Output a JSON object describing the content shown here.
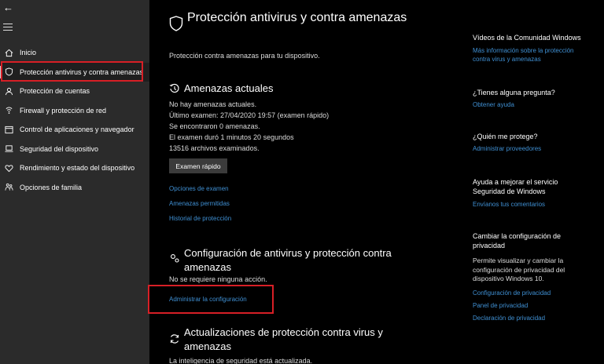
{
  "sidebar": {
    "back_glyph": "←",
    "items": [
      {
        "label": "Inicio",
        "icon": "home-icon"
      },
      {
        "label": "Protección antivirus y contra amenazas",
        "icon": "shield-icon"
      },
      {
        "label": "Protección de cuentas",
        "icon": "person-icon"
      },
      {
        "label": "Firewall y protección de red",
        "icon": "wifi-icon"
      },
      {
        "label": "Control de aplicaciones y navegador",
        "icon": "window-icon"
      },
      {
        "label": "Seguridad del dispositivo",
        "icon": "laptop-icon"
      },
      {
        "label": "Rendimiento y estado del dispositivo",
        "icon": "heart-icon"
      },
      {
        "label": "Opciones de familia",
        "icon": "family-icon"
      }
    ]
  },
  "main": {
    "title": "Protección antivirus y contra amenazas",
    "subtitle": "Protección contra amenazas para tu dispositivo.",
    "threats": {
      "title": "Amenazas actuales",
      "lines": [
        "No hay amenazas actuales.",
        "Último examen: 27/04/2020 19:57 (examen rápido)",
        "Se encontraron 0 amenazas.",
        "El examen duró 1 minutos 20 segundos",
        "13516 archivos examinados."
      ],
      "button": "Examen rápido",
      "links": [
        "Opciones de examen",
        "Amenazas permitidas",
        "Historial de protección"
      ]
    },
    "settings": {
      "title": "Configuración de antivirus y protección contra amenazas",
      "status": "No se requiere ninguna acción.",
      "link": "Administrar la configuración"
    },
    "updates": {
      "title": "Actualizaciones de protección contra virus y amenazas",
      "status": "La inteligencia de seguridad está actualizada."
    }
  },
  "right": {
    "community": {
      "head": "Vídeos de la Comunidad Windows",
      "link": "Más información sobre la protección contra virus y amenazas"
    },
    "question": {
      "head": "¿Tienes alguna pregunta?",
      "link": "Obtener ayuda"
    },
    "protects": {
      "head": "¿Quién me protege?",
      "link": "Administrar proveedores"
    },
    "improve": {
      "head": "Ayuda a mejorar el servicio Seguridad de Windows",
      "link": "Envíanos tus comentarios"
    },
    "privacy": {
      "head": "Cambiar la configuración de privacidad",
      "text": "Permite visualizar y cambiar la configuración de privacidad del dispositivo Windows 10.",
      "links": [
        "Configuración de privacidad",
        "Panel de privacidad",
        "Declaración de privacidad"
      ]
    }
  },
  "colors": {
    "accent": "#3f8fd2",
    "highlight": "#d71f26",
    "sidebar": "#2b2b2b"
  }
}
